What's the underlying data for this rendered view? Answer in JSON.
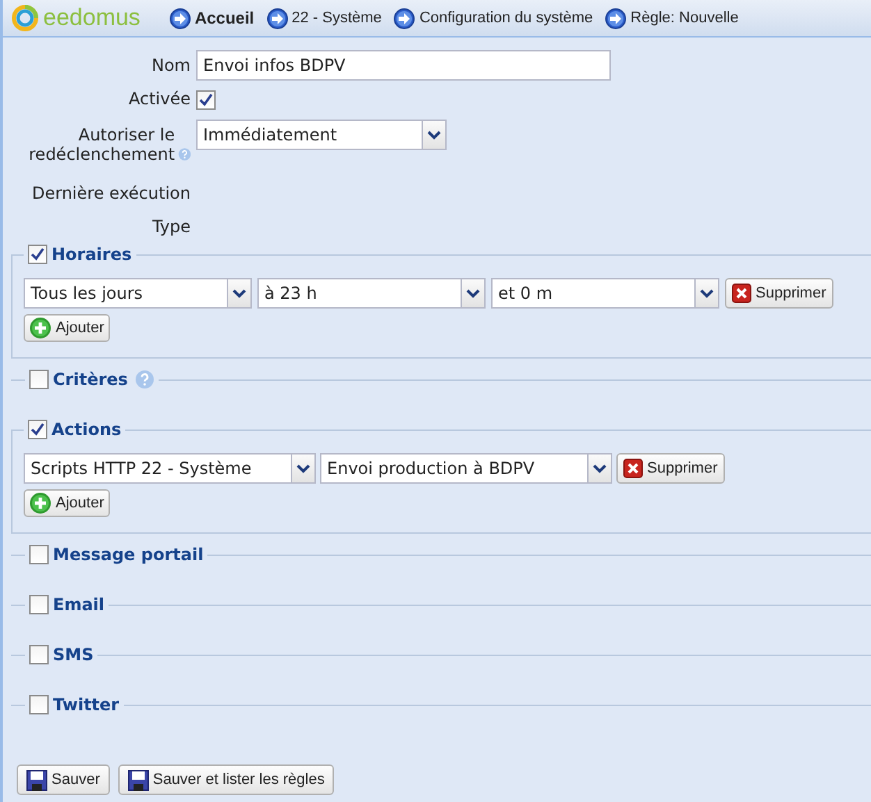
{
  "header": {
    "logo": "eedomus",
    "breadcrumb": [
      {
        "label": "Accueil",
        "bold": true
      },
      {
        "label": "22 - Système",
        "bold": false
      },
      {
        "label": "Configuration du système",
        "bold": false
      },
      {
        "label": "Règle: Nouvelle",
        "bold": false
      }
    ]
  },
  "form": [
    {
      "kind": "text",
      "label": "Nom",
      "value": "Envoi infos BDPV"
    },
    {
      "kind": "checkbox",
      "label": "Activée",
      "checked": true
    },
    {
      "kind": "select",
      "label": "Autoriser le redéclenchement",
      "help": true,
      "value": "Immédiatement"
    },
    {
      "kind": "info",
      "label": "Dernière exécution"
    },
    {
      "kind": "info",
      "label": "Type"
    }
  ],
  "sections": [
    {
      "title": "Horaires",
      "checked": true,
      "rows": [
        {
          "selects": [
            "Tous les jours",
            "à 23 h",
            "et 0 m"
          ],
          "remove": "Supprimer"
        }
      ],
      "add": "Ajouter"
    },
    {
      "title": "Critères",
      "checked": false,
      "help": true
    },
    {
      "title": "Actions",
      "checked": true,
      "rows": [
        {
          "selects": [
            "Scripts HTTP 22 - Système",
            "Envoi production à BDPV"
          ],
          "remove": "Supprimer"
        }
      ],
      "add": "Ajouter"
    },
    {
      "title": "Message portail",
      "checked": false
    },
    {
      "title": "Email",
      "checked": false
    },
    {
      "title": "SMS",
      "checked": false
    },
    {
      "title": "Twitter",
      "checked": false
    }
  ],
  "buttons": [
    "Sauver",
    "Sauver et lister les règles"
  ]
}
